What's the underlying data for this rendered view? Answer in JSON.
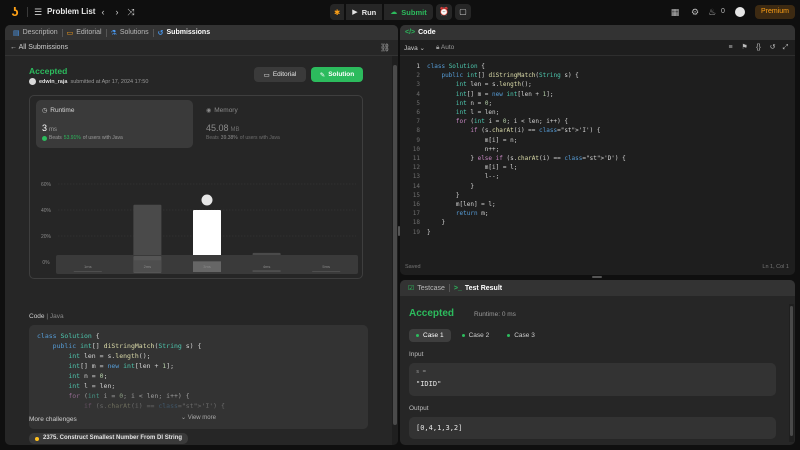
{
  "topbar": {
    "problem_list": "Problem List",
    "run_label": "Run",
    "submit_label": "Submit",
    "streak_count": "0",
    "premium_label": "Premium"
  },
  "left": {
    "tabs": [
      {
        "label": "Description",
        "icon": "description-icon"
      },
      {
        "label": "Editorial",
        "icon": "editorial-icon"
      },
      {
        "label": "Solutions",
        "icon": "flask-icon"
      },
      {
        "label": "Submissions",
        "icon": "history-icon"
      }
    ],
    "back_label": "All Submissions",
    "status": "Accepted",
    "username": "edwin_raja",
    "submitted_at": "submitted at Apr 17, 2024 17:50",
    "editorial_btn": "Editorial",
    "solution_btn": "Solution",
    "runtime": {
      "title": "Runtime",
      "value": "3",
      "unit": "ms",
      "beats_prefix": "Beats",
      "beats_pct": "53.91%",
      "beats_suffix": "of users with Java"
    },
    "memory": {
      "title": "Memory",
      "value": "45.08",
      "unit": "MB",
      "beats_prefix": "Beats",
      "beats_pct": "39.38%",
      "beats_suffix": "of users with Java"
    },
    "code_label": "Code",
    "code_lang": "Java",
    "code_lines": [
      "class Solution {",
      "    public int[] diStringMatch(String s) {",
      "        int len = s.length();",
      "        int[] m = new int[len + 1];",
      "        int n = 0;",
      "        int l = len;",
      "        for (int i = 0; i < len; i++) {",
      "            if (s.charAt(i) == 'I') {"
    ],
    "view_more": "View more",
    "more_challenges": "More challenges",
    "challenge_1": "2375. Construct Smallest Number From DI String"
  },
  "chart_data": {
    "type": "bar",
    "categories": [
      "1ms",
      "2ms",
      "3ms",
      "4ms",
      "5ms"
    ],
    "values": [
      1,
      44,
      40,
      7,
      1
    ],
    "highlight_index": 2,
    "ylim": [
      0,
      60
    ],
    "yticks": [
      "60%",
      "40%",
      "20%",
      "0%"
    ],
    "ytick_values": [
      60,
      40,
      20,
      0
    ],
    "grid": true,
    "xlabel": "",
    "ylabel": "",
    "bar_color": "#4a4a4a",
    "highlight_color": "#ffffff"
  },
  "editor": {
    "title": "Code",
    "language": "Java",
    "auto": "Auto",
    "status_left": "Saved",
    "status_right": "Ln 1, Col 1",
    "line_numbers": [
      "1",
      "2",
      "3",
      "4",
      "5",
      "6",
      "7",
      "8",
      "9",
      "10",
      "11",
      "12",
      "13",
      "14",
      "15",
      "16",
      "17",
      "18",
      "19"
    ],
    "lines": [
      "class Solution {",
      "    public int[] diStringMatch(String s) {",
      "        int len = s.length();",
      "        int[] m = new int[len + 1];",
      "        int n = 0;",
      "        int l = len;",
      "        for (int i = 0; i < len; i++) {",
      "            if (s.charAt(i) == 'I') {",
      "                m[i] = n;",
      "                n++;",
      "            } else if (s.charAt(i) == 'D') {",
      "                m[i] = l;",
      "                l--;",
      "            }",
      "        }",
      "        m[len] = l;",
      "        return m;",
      "    }",
      "}"
    ]
  },
  "result": {
    "testcase_tab": "Testcase",
    "result_tab": "Test Result",
    "status": "Accepted",
    "runtime": "Runtime: 0 ms",
    "cases": [
      "Case 1",
      "Case 2",
      "Case 3"
    ],
    "input_label": "Input",
    "input_var": "s =",
    "input_value": "\"IDID\"",
    "output_label": "Output",
    "output_value": "[0,4,1,3,2]"
  }
}
